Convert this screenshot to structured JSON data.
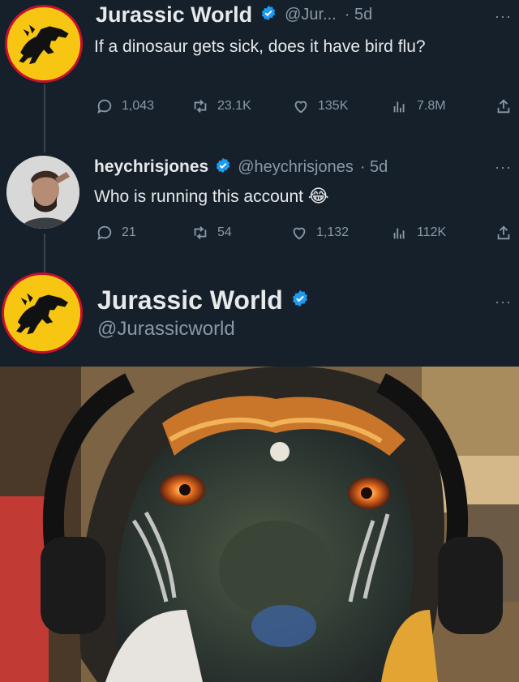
{
  "tweets": [
    {
      "display_name": "Jurassic World",
      "handle": "@Jur...",
      "time": "· 5d",
      "more_label": "···",
      "text": "If a dinosaur gets sick, does it have bird flu?",
      "actions": {
        "replies": "1,043",
        "retweets": "23.1K",
        "likes": "135K",
        "views": "7.8M"
      }
    },
    {
      "display_name": "heychrisjones",
      "handle": "@heychrisjones",
      "time": "· 5d",
      "more_label": "···",
      "text": "Who is running this account",
      "emoji": "😂",
      "actions": {
        "replies": "21",
        "retweets": "54",
        "likes": "1,132",
        "views": "112K"
      }
    }
  ],
  "reply_profile": {
    "display_name": "Jurassic World",
    "handle": "@Jurassicworld",
    "more_label": "···"
  },
  "colors": {
    "background": "#15202b",
    "verified_blue": "#1d9bf0",
    "muted": "#8b98a5",
    "jw_yellow": "#f7c613",
    "jw_red": "#c8102e"
  },
  "icons": [
    "reply-icon",
    "retweet-icon",
    "like-icon",
    "views-icon",
    "share-icon",
    "verified-icon"
  ]
}
